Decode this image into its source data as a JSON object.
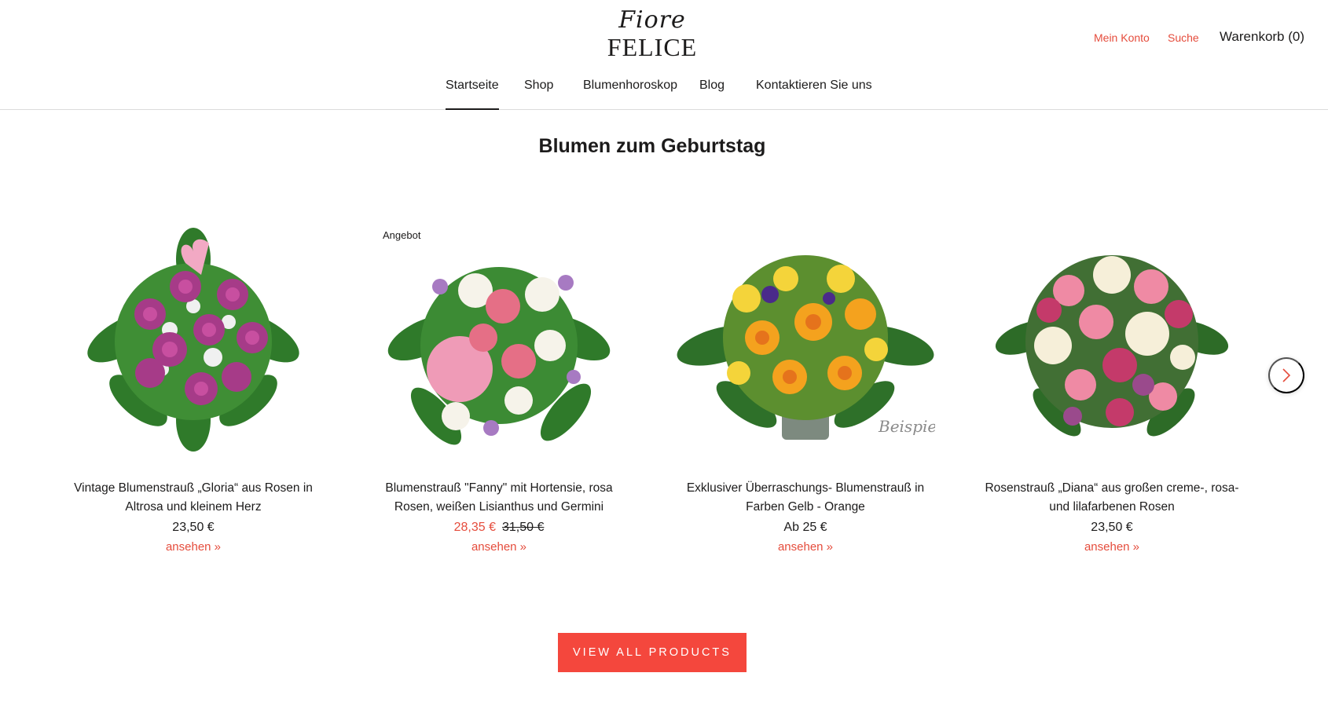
{
  "header": {
    "logo_script": "Fiore",
    "logo_main": "FELICE",
    "account_label": "Mein Konto",
    "search_label": "Suche",
    "cart_label": "Warenkorb (0)"
  },
  "nav": {
    "items": [
      {
        "label": "Startseite",
        "active": true
      },
      {
        "label": "Shop"
      },
      {
        "label": "Blumenhoroskop"
      },
      {
        "label": "Blog"
      },
      {
        "label": "Kontaktieren Sie uns"
      }
    ]
  },
  "section": {
    "title": "Blumen zum Geburtstag"
  },
  "products": [
    {
      "title": "Vintage Blumenstrauß „Gloria“ aus Rosen in Altrosa und kleinem Herz",
      "price": "23,50 €",
      "link": "ansehen »"
    },
    {
      "badge": "Angebot",
      "title": "Blumenstrauß \"Fanny\" mit Hortensie, rosa Rosen, weißen Lisianthus und Germini",
      "sale_price": "28,35 €",
      "old_price": "31,50 €",
      "link": "ansehen »"
    },
    {
      "title": "Exklusiver Überraschungs- Blumenstrauß in Farben Gelb - Orange",
      "price": "Ab 25 €",
      "link": "ansehen »",
      "watermark": "Beispiel"
    },
    {
      "title": "Rosenstrauß „Diana“ aus großen creme-, rosa- und lilafarbenen Rosen",
      "price": "23,50 €",
      "link": "ansehen »"
    }
  ],
  "carousel": {
    "next_icon": "chevron-right-icon"
  },
  "cta": {
    "label": "VIEW ALL PRODUCTS"
  },
  "colors": {
    "accent": "#e54c3c",
    "button": "#f4473d",
    "text": "#1c1b1b"
  }
}
